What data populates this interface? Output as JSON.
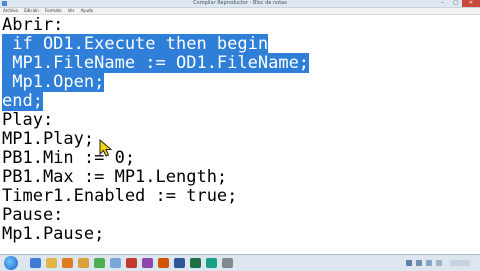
{
  "window": {
    "title": "Compilar Reproductor - Bloc de notas",
    "menu": [
      "Archivo",
      "Edición",
      "Formato",
      "Ver",
      "Ayuda"
    ],
    "controls": {
      "minimize": "–",
      "maximize": "□",
      "close": "✕"
    }
  },
  "editor": {
    "lines": [
      {
        "text": "Abrir:",
        "selected": false
      },
      {
        "text": " if OD1.Execute then begin",
        "selected": true
      },
      {
        "text": " MP1.FileName := OD1.FileName;",
        "selected": true
      },
      {
        "text": " Mp1.Open;",
        "selected": true
      },
      {
        "text": "end;",
        "selected": true
      },
      {
        "text": "Play:",
        "selected": false
      },
      {
        "text": "MP1.Play;",
        "selected": false
      },
      {
        "text": "PB1.Min := 0;",
        "selected": false
      },
      {
        "text": "PB1.Max := MP1.Length;",
        "selected": false
      },
      {
        "text": "Timer1.Enabled := true;",
        "selected": false
      },
      {
        "text": "Pause:",
        "selected": false
      },
      {
        "text": "Mp1.Pause;",
        "selected": false
      }
    ],
    "selection_color": "#2f7fd8"
  },
  "taskbar": {
    "icons": [
      {
        "name": "start-orb-icon"
      },
      {
        "name": "ie-icon",
        "color": "#3d7bd6"
      },
      {
        "name": "explorer-icon",
        "color": "#e2b648"
      },
      {
        "name": "media-player-icon",
        "color": "#e07b24"
      },
      {
        "name": "folder-icon",
        "color": "#d9a13b"
      },
      {
        "name": "chrome-icon",
        "color": "#4caf50"
      },
      {
        "name": "notepad-icon",
        "color": "#7aa7d9"
      },
      {
        "name": "paint-icon",
        "color": "#c0392b"
      },
      {
        "name": "app-icon",
        "color": "#8e44ad"
      },
      {
        "name": "delphi-icon",
        "color": "#d35400"
      },
      {
        "name": "word-icon",
        "color": "#2b5797"
      },
      {
        "name": "excel-icon",
        "color": "#1e7145"
      },
      {
        "name": "app2-icon",
        "color": "#16a085"
      },
      {
        "name": "app3-icon",
        "color": "#7f8c8d"
      }
    ]
  }
}
